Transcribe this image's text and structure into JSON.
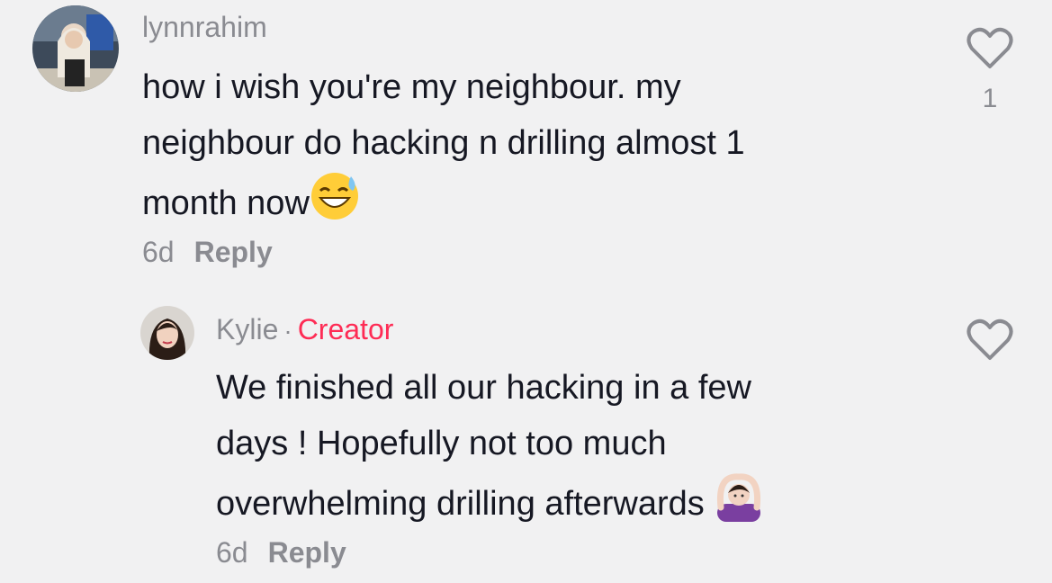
{
  "comments": [
    {
      "username": "lynnrahim",
      "text_lines": [
        "how i wish you're my neighbour. my",
        "neighbour do hacking n drilling almost 1",
        "month now"
      ],
      "emoji": "sweat-smile-emoji",
      "age": "6d",
      "reply_label": "Reply",
      "like_count": "1"
    },
    {
      "username": "Kylie",
      "separator": "·",
      "badge": "Creator",
      "text_lines": [
        "We finished all our hacking in a few",
        "days ! Hopefully not too much",
        "overwhelming drilling afterwards"
      ],
      "emoji": "person-gesturing-ok-emoji",
      "age": "6d",
      "reply_label": "Reply"
    }
  ],
  "colors": {
    "background": "#f1f1f2",
    "text": "#161823",
    "muted": "#8a8b91",
    "creator_badge": "#fe2c55"
  }
}
